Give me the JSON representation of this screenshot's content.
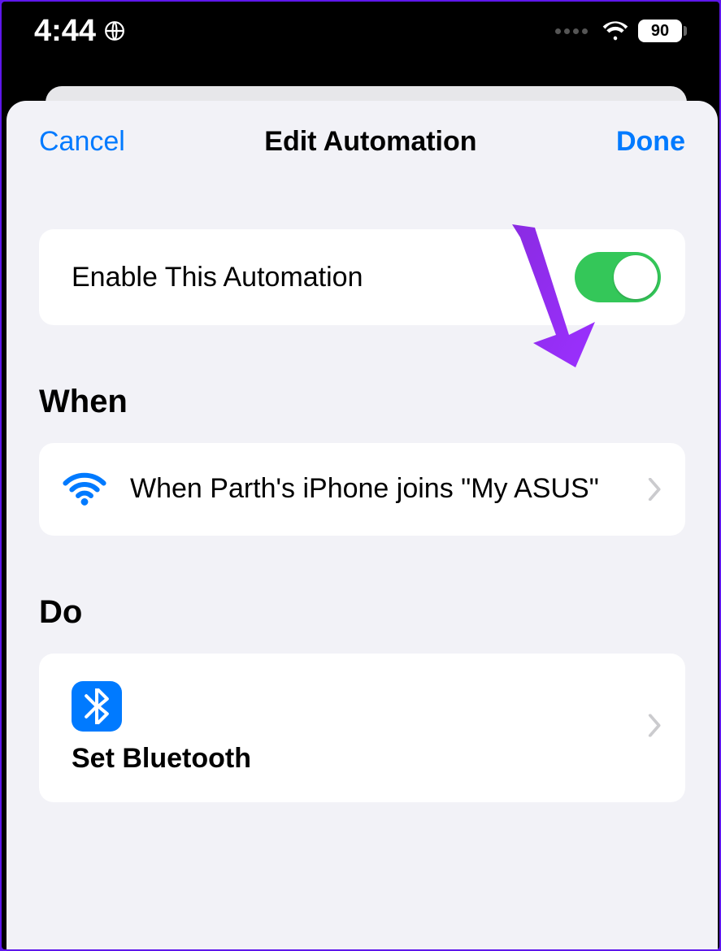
{
  "status_bar": {
    "time": "4:44",
    "battery": "90"
  },
  "nav": {
    "cancel": "Cancel",
    "title": "Edit Automation",
    "done": "Done"
  },
  "enable": {
    "label": "Enable This Automation",
    "on": true
  },
  "sections": {
    "when_header": "When",
    "do_header": "Do"
  },
  "when": {
    "text": "When Parth's iPhone joins \"My ASUS\""
  },
  "do": {
    "label": "Set Bluetooth"
  }
}
